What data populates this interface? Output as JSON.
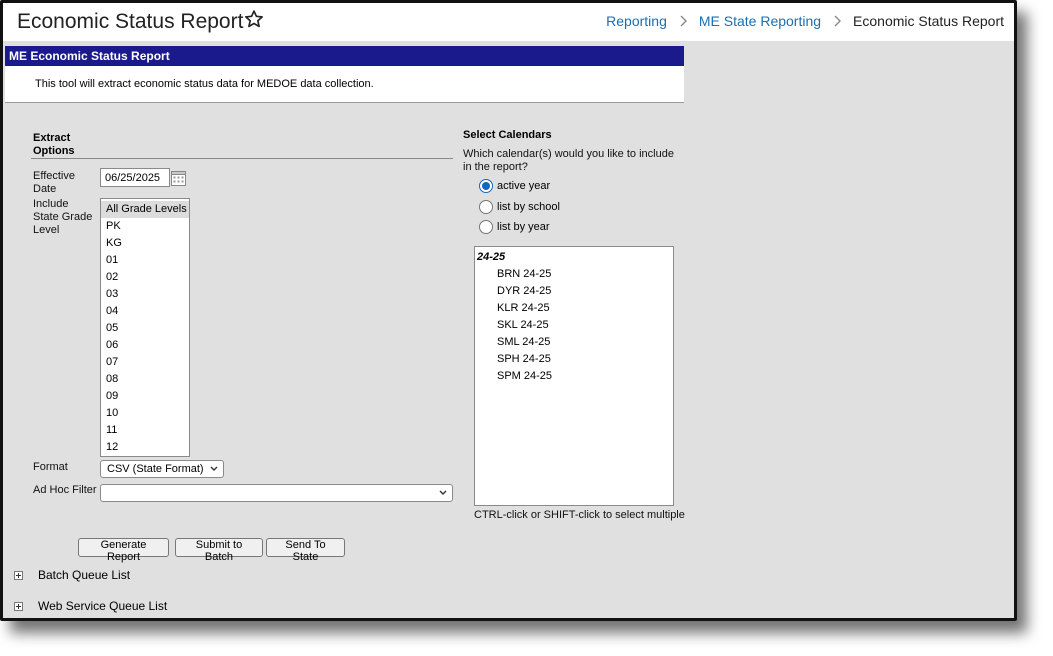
{
  "header": {
    "title": "Economic Status Report",
    "breadcrumb": [
      "Reporting",
      "ME State Reporting",
      "Economic Status Report"
    ]
  },
  "panel": {
    "title": "ME Economic Status Report",
    "description": "This tool will extract economic status data for MEDOE data collection."
  },
  "extract": {
    "section_title": "Extract Options",
    "effective_date_label": "Effective Date",
    "effective_date_value": "06/25/2025",
    "grade_label": "Include State Grade Level",
    "grades": [
      "All Grade Levels",
      "PK",
      "KG",
      "01",
      "02",
      "03",
      "04",
      "05",
      "06",
      "07",
      "08",
      "09",
      "10",
      "11",
      "12"
    ],
    "grade_selected": "All Grade Levels",
    "format_label": "Format",
    "format_value": "CSV (State Format)",
    "adhoc_label": "Ad Hoc Filter",
    "adhoc_value": ""
  },
  "calendars": {
    "section_title": "Select Calendars",
    "question": "Which calendar(s) would you like to include in the report?",
    "options": [
      "active year",
      "list by school",
      "list by year"
    ],
    "selected": "active year",
    "group": "24-25",
    "items": [
      "BRN 24-25",
      "DYR 24-25",
      "KLR 24-25",
      "SKL 24-25",
      "SML 24-25",
      "SPH 24-25",
      "SPM 24-25"
    ],
    "hint": "CTRL-click or SHIFT-click to select multiple"
  },
  "buttons": {
    "generate": "Generate Report",
    "batch": "Submit to Batch",
    "state": "Send To State"
  },
  "lists": {
    "batch_queue": "Batch Queue List",
    "web_service_queue": "Web Service Queue List"
  },
  "colors": {
    "panel_header": "#1a1a8c",
    "link": "#1a6fb3",
    "radio_selected": "#1565c0",
    "background": "#e0e0e0"
  }
}
